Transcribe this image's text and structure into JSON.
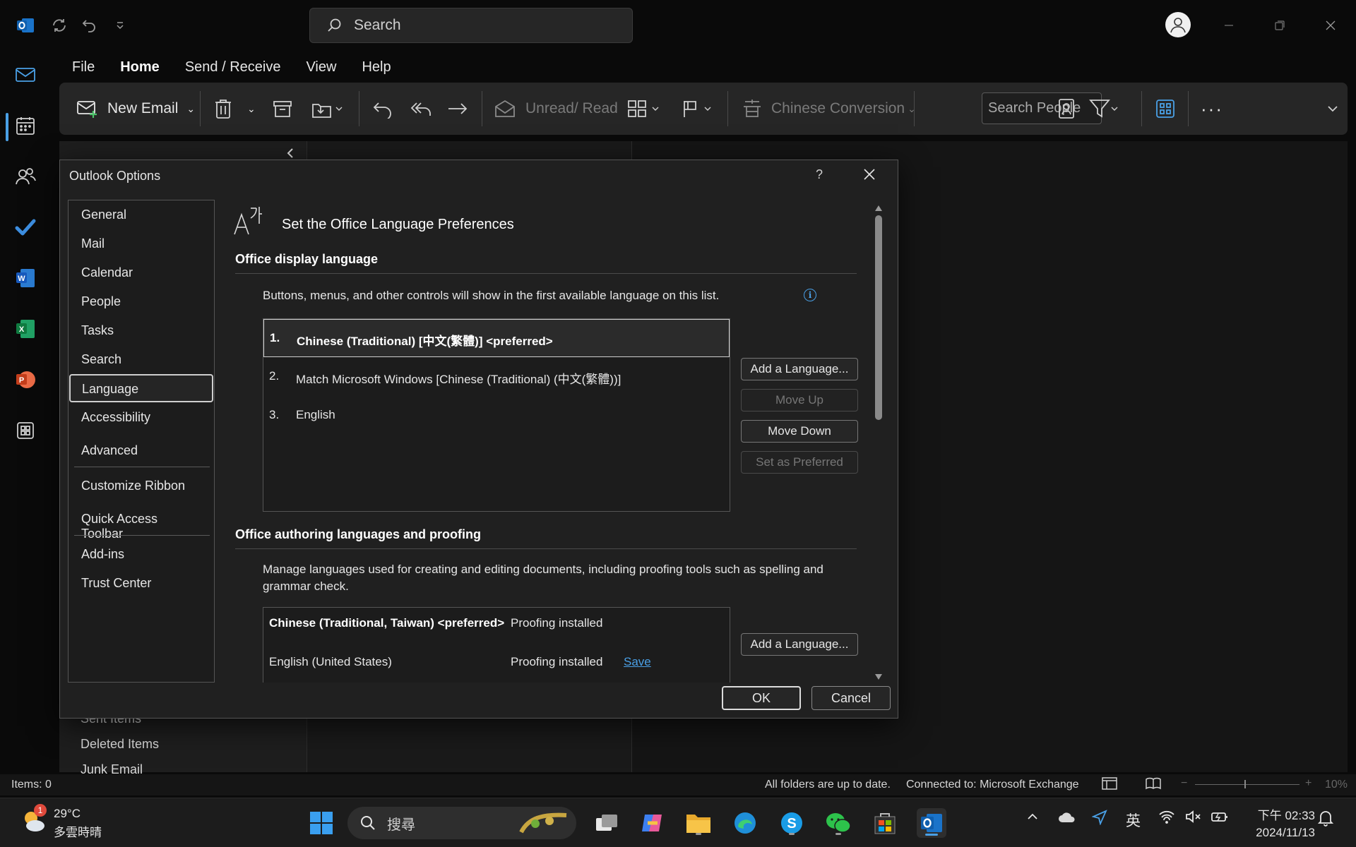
{
  "titlebar": {
    "search_placeholder": "Search"
  },
  "menu": {
    "tabs": [
      "File",
      "Home",
      "Send / Receive",
      "View",
      "Help"
    ],
    "active": "Home"
  },
  "ribbon": {
    "new_email": "New Email",
    "unread_read": "Unread/ Read",
    "chinese_conversion": "Chinese Conversion",
    "search_people": "Search People"
  },
  "background": {
    "folders": [
      "Sent Items",
      "Deleted Items",
      "Junk Email"
    ]
  },
  "dialog": {
    "title": "Outlook Options",
    "help": "?",
    "nav": [
      "General",
      "Mail",
      "Calendar",
      "People",
      "Tasks",
      "Search",
      "Language",
      "Accessibility",
      "Advanced",
      "Customize Ribbon",
      "Quick Access Toolbar",
      "Add-ins",
      "Trust Center"
    ],
    "selected_nav": "Language",
    "heading": "Set the Office Language Preferences",
    "display_section": {
      "title": "Office display language",
      "description": "Buttons, menus, and other controls will show in the first available language on this list.",
      "languages": [
        {
          "num": "1.",
          "name": "Chinese (Traditional) [中文(繁體)] <preferred>"
        },
        {
          "num": "2.",
          "name": "Match Microsoft Windows [Chinese (Traditional) (中文(繁體))]"
        },
        {
          "num": "3.",
          "name": "English"
        }
      ],
      "buttons": {
        "add": "Add a Language...",
        "move_up": "Move Up",
        "move_down": "Move Down",
        "set_preferred": "Set as Preferred"
      }
    },
    "authoring_section": {
      "title": "Office authoring languages and proofing",
      "description": "Manage languages used for creating and editing documents, including proofing tools such as spelling and grammar check.",
      "languages": [
        {
          "name": "Chinese (Traditional, Taiwan) <preferred>",
          "status": "Proofing installed",
          "link": ""
        },
        {
          "name": "English (United States)",
          "status": "Proofing installed",
          "link": "Save"
        }
      ],
      "add_button": "Add a Language..."
    },
    "ok": "OK",
    "cancel": "Cancel"
  },
  "statusbar": {
    "items": "Items: 0",
    "sync": "All folders are up to date.",
    "connection": "Connected to: Microsoft Exchange",
    "zoom": "10%"
  },
  "taskbar": {
    "temperature": "29°C",
    "weather": "多雲時晴",
    "weather_badge": "1",
    "search_label": "搜尋",
    "ime": "英",
    "time": "下午 02:33",
    "date": "2024/11/13"
  },
  "colors": {
    "accent": "#4aa0e6",
    "dialog_bg": "#202020",
    "app_bg": "#0a0a0a"
  }
}
